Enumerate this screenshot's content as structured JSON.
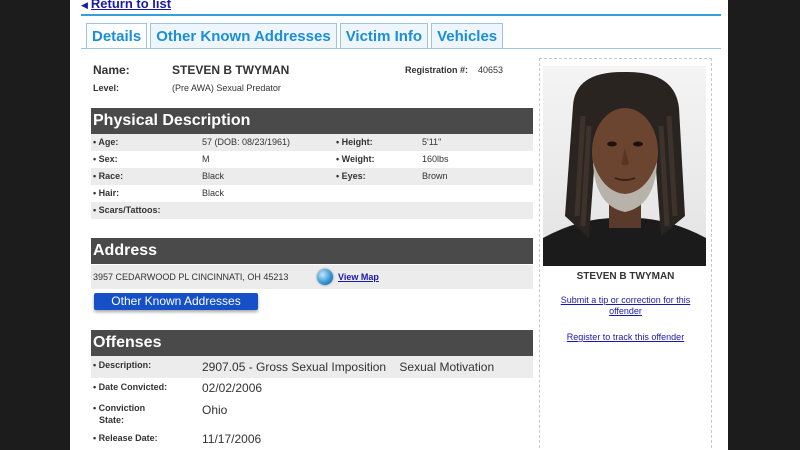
{
  "nav": {
    "return_label": "Return to list"
  },
  "tabs": [
    {
      "label": "Details"
    },
    {
      "label": "Other Known Addresses"
    },
    {
      "label": "Victim Info"
    },
    {
      "label": "Vehicles"
    }
  ],
  "offender": {
    "name_label": "Name:",
    "name": "STEVEN B TWYMAN",
    "level_label": "Level:",
    "level": "(Pre AWA) Sexual Predator",
    "registration_label": "Registration #:",
    "registration": "40653"
  },
  "physical": {
    "heading": "Physical Description",
    "age_label": "• Age:",
    "age": "57  (DOB: 08/23/1961)",
    "height_label": "• Height:",
    "height": "5'11\"",
    "sex_label": "• Sex:",
    "sex": "M",
    "weight_label": "• Weight:",
    "weight": "160lbs",
    "race_label": "• Race:",
    "race": "Black",
    "eyes_label": "• Eyes:",
    "eyes": "Brown",
    "hair_label": "• Hair:",
    "hair": "Black",
    "scars_label": "• Scars/Tattoos:",
    "scars": ""
  },
  "address": {
    "heading": "Address",
    "line": "3957 CEDARWOOD PL CINCINNATI, OH 45213",
    "view_map": "View Map",
    "other_button": "Other Known Addresses"
  },
  "offenses": {
    "heading": "Offenses",
    "description_label": "• Description:",
    "description": "2907.05 - Gross Sexual Imposition    Sexual Motivation",
    "convicted_label": "• Date Convicted:",
    "convicted": "02/02/2006",
    "state_label_1": "• Conviction",
    "state_label_2": "State:",
    "state": "Ohio",
    "release_label": "• Release Date:",
    "release": "11/17/2006"
  },
  "sidebar": {
    "photo_caption": "STEVEN B TWYMAN",
    "tip_line1": "Submit a tip or correction for this",
    "tip_line2": "offender",
    "register": "Register to track this offender"
  },
  "colors": {
    "accent": "#1a8fd6",
    "section_header": "#4a4a4a",
    "link": "#1a1aa8",
    "button": "#1550c8"
  }
}
